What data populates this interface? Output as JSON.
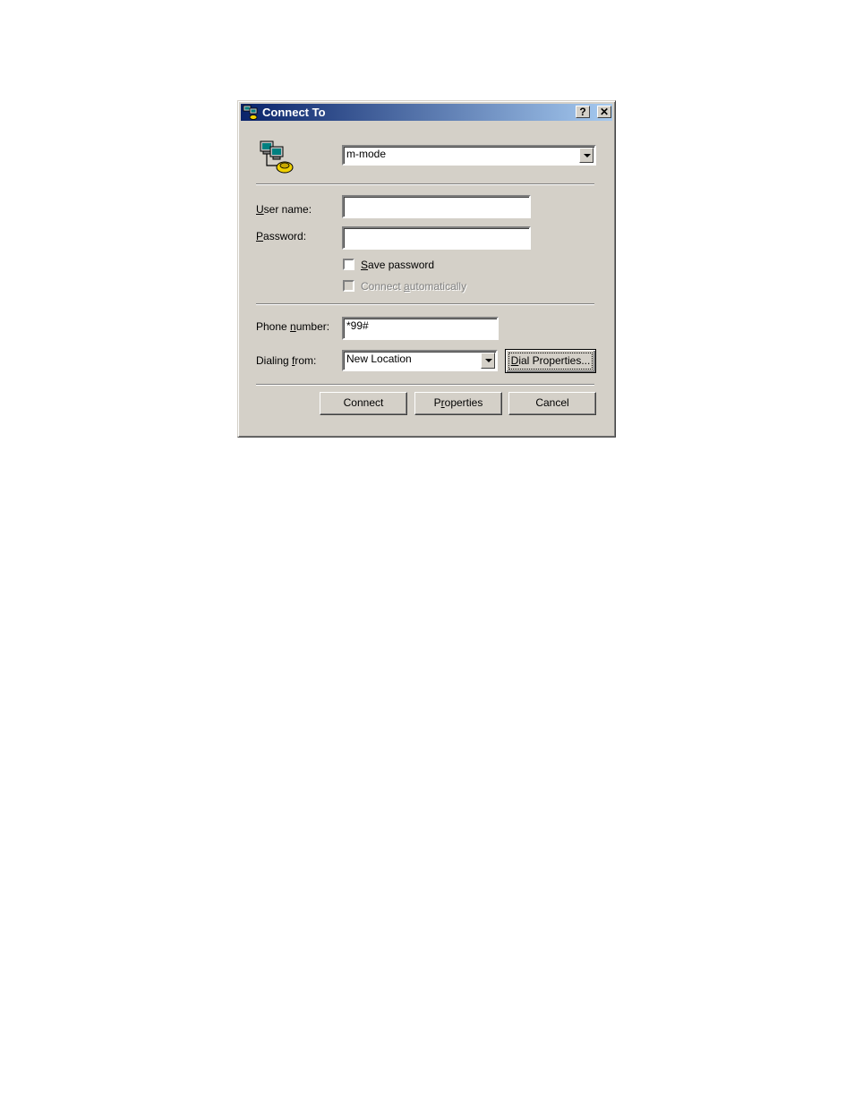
{
  "window": {
    "title": "Connect To",
    "help_button": "?",
    "close_button": "✕"
  },
  "connection": {
    "selected": "m-mode"
  },
  "form": {
    "username_label_u": "U",
    "username_label_rest": "ser name:",
    "username_value": "",
    "password_label_u": "P",
    "password_label_rest": "assword:",
    "password_value": "",
    "save_password_u": "S",
    "save_password_rest": "ave password",
    "connect_auto_pre": "Connect ",
    "connect_auto_u": "a",
    "connect_auto_rest": "utomatically",
    "phone_label_pre": "Phone ",
    "phone_label_u": "n",
    "phone_label_rest": "umber:",
    "phone_value": "*99#",
    "dialing_label_pre": "Dialing ",
    "dialing_label_u": "f",
    "dialing_label_rest": "rom:",
    "dialing_value": "New Location"
  },
  "buttons": {
    "dial_properties_u": "D",
    "dial_properties_rest": "ial Properties...",
    "connect": "Connect",
    "properties_pre": "P",
    "properties_u": "r",
    "properties_rest": "operties",
    "cancel": "Cancel"
  },
  "colors": {
    "dialog_face": "#d4d0c8",
    "titlebar_start": "#0a246a",
    "titlebar_end": "#a6caf0"
  }
}
